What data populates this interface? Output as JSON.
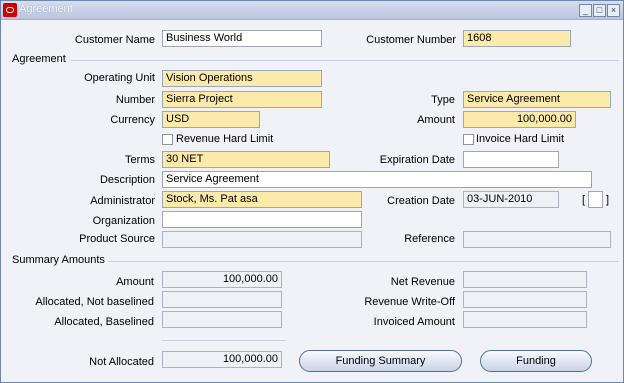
{
  "window": {
    "title": "Agreement",
    "minimize": "_",
    "maximize": "□",
    "close": "×"
  },
  "customer": {
    "name_label": "Customer Name",
    "name_value": "Business World",
    "number_label": "Customer Number",
    "number_value": "1608"
  },
  "agreement": {
    "section_label": "Agreement",
    "operating_unit_label": "Operating Unit",
    "operating_unit_value": "Vision Operations",
    "number_label": "Number",
    "number_value": "Sierra Project",
    "type_label": "Type",
    "type_value": "Service Agreement",
    "currency_label": "Currency",
    "currency_value": "USD",
    "amount_label": "Amount",
    "amount_value": "100,000.00",
    "revenue_hard_limit_label": "Revenue Hard Limit",
    "invoice_hard_limit_label": "Invoice Hard Limit",
    "terms_label": "Terms",
    "terms_value": "30 NET",
    "expiration_date_label": "Expiration Date",
    "expiration_date_value": "",
    "description_label": "Description",
    "description_value": "Service Agreement",
    "administrator_label": "Administrator",
    "administrator_value": "Stock, Ms. Pat asa",
    "creation_date_label": "Creation Date",
    "creation_date_value": "03-JUN-2010",
    "organization_label": "Organization",
    "organization_value": "",
    "product_source_label": "Product Source",
    "product_source_value": "",
    "reference_label": "Reference",
    "reference_value": "",
    "bracket_open": "[",
    "bracket_close": "]"
  },
  "summary": {
    "section_label": "Summary Amounts",
    "amount_label": "Amount",
    "amount_value": "100,000.00",
    "net_revenue_label": "Net Revenue",
    "net_revenue_value": "",
    "alloc_not_baselined_label": "Allocated, Not baselined",
    "alloc_not_baselined_value": "",
    "revenue_writeoff_label": "Revenue Write-Off",
    "revenue_writeoff_value": "",
    "alloc_baselined_label": "Allocated, Baselined",
    "alloc_baselined_value": "",
    "invoiced_amount_label": "Invoiced Amount",
    "invoiced_amount_value": "",
    "not_allocated_label": "Not Allocated",
    "not_allocated_value": "100,000.00"
  },
  "buttons": {
    "funding_summary": "Funding Summary",
    "funding": "Funding"
  },
  "colors": {
    "required_field": "#fbeaa9",
    "window_bg": "#f0f2f7",
    "title_bar": "#b9c5e0"
  }
}
